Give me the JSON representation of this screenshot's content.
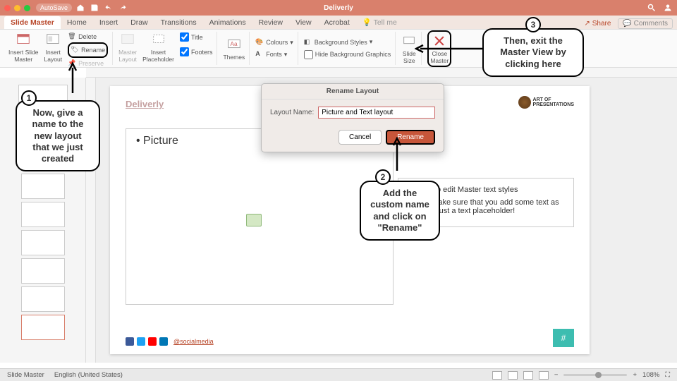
{
  "titlebar": {
    "autosave": "AutoSave",
    "doc": "Deliverly"
  },
  "tabs": {
    "items": [
      "Slide Master",
      "Home",
      "Insert",
      "Draw",
      "Transitions",
      "Animations",
      "Review",
      "View",
      "Acrobat"
    ],
    "tellme": "Tell me",
    "share": "Share",
    "comments": "Comments"
  },
  "ribbon": {
    "insert_slide_master": "Insert Slide\nMaster",
    "insert_layout": "Insert\nLayout",
    "delete": "Delete",
    "rename": "Rename",
    "preserve": "Preserve",
    "master_layout": "Master\nLayout",
    "insert_placeholder": "Insert\nPlaceholder",
    "title_cb": "Title",
    "footers_cb": "Footers",
    "themes": "Themes",
    "colours": "Colours",
    "fonts": "Fonts",
    "bg_styles": "Background Styles",
    "hide_bg": "Hide Background Graphics",
    "slide_size": "Slide\nSize",
    "close_master": "Close\nMaster"
  },
  "slide": {
    "brand": "Deliverly",
    "pic_bullet": "Picture",
    "text_items": [
      "Click to edit Master text styles",
      "Just make sure that you add some text as this is just a text placeholder!"
    ],
    "social_handle": "@socialmedia",
    "pagenum": "#",
    "logo_text": "ART OF\nPRESENTATIONS"
  },
  "dialog": {
    "title": "Rename Layout",
    "label": "Layout Name:",
    "value": "Picture and Text layout",
    "cancel": "Cancel",
    "rename": "Rename"
  },
  "callouts": {
    "c1": "Now, give a name to the new layout that we just created",
    "c2": "Add the custom name and click on \"Rename\"",
    "c3": "Then, exit the Master View by clicking here"
  },
  "status": {
    "mode": "Slide Master",
    "lang": "English (United States)",
    "zoom": "108%"
  }
}
